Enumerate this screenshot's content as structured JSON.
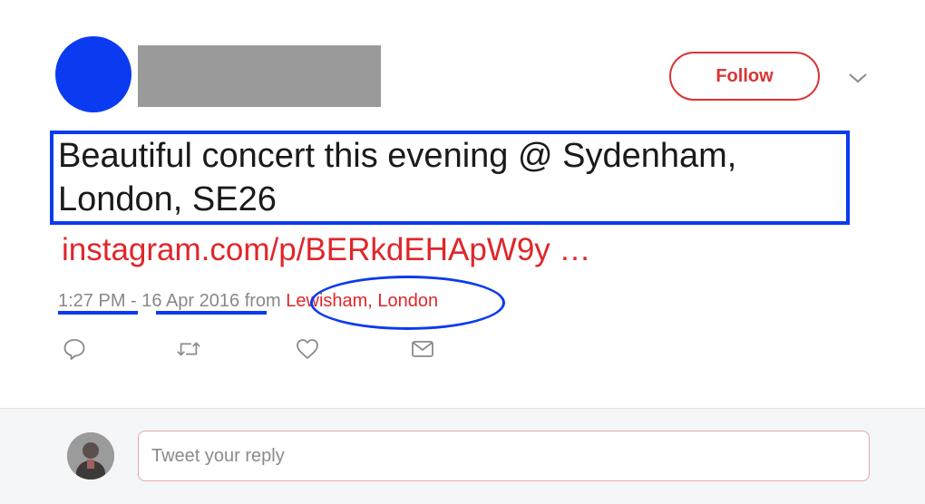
{
  "header": {
    "follow_label": "Follow"
  },
  "tweet": {
    "text_line1": "Beautiful concert this evening @ Sydenham,",
    "text_line2": "London, SE26",
    "link": "instagram.com/p/BERkdEHApW9y …",
    "time": "1:27 PM",
    "separator": " - ",
    "date": "16 Apr 2016",
    "from_label": " from ",
    "location": "Lewisham, London"
  },
  "actions": [
    {
      "icon": "reply-icon"
    },
    {
      "icon": "retweet-icon"
    },
    {
      "icon": "like-icon"
    },
    {
      "icon": "message-icon"
    }
  ],
  "reply": {
    "placeholder": "Tweet your reply"
  },
  "colors": {
    "annotation_blue": "#0b3bf0",
    "accent_red": "#e0262a",
    "follow_red": "#d93434",
    "muted_gray": "#888888"
  }
}
